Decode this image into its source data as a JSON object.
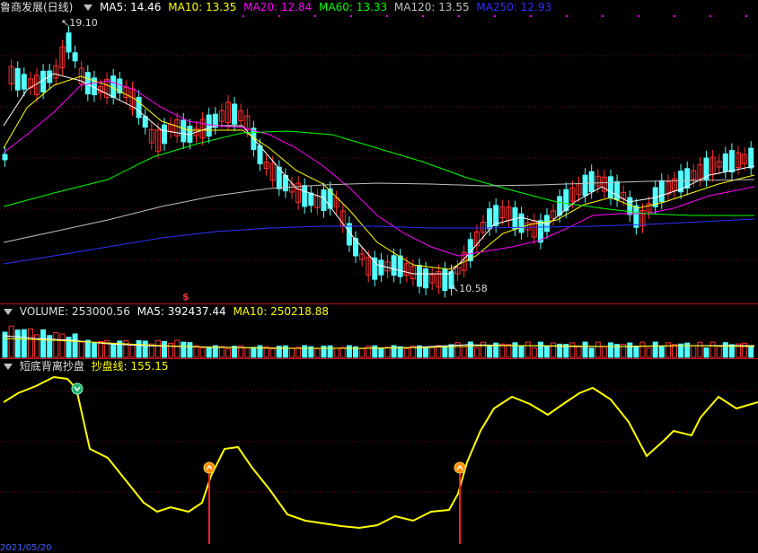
{
  "header": {
    "title": "鲁商发展(日线)",
    "indicators": [
      {
        "label": "MA5: 14.46",
        "color": "#ffffff"
      },
      {
        "label": "MA10: 13.35",
        "color": "#ffff00"
      },
      {
        "label": "MA20: 12.84",
        "color": "#ff00ff"
      },
      {
        "label": "MA60: 13.33",
        "color": "#00ff00"
      },
      {
        "label": "MA120: 13.55",
        "color": "#c0c0c0"
      },
      {
        "label": "MA250: 12.93",
        "color": "#3030ff"
      }
    ]
  },
  "price_chart": {
    "high_label": "19.10",
    "low_label": "10.58",
    "signal_glyph": "$"
  },
  "volume": {
    "title": "VOLUME: 253000.56",
    "ma5": "MA5: 392437.44",
    "ma10": "MA10: 250218.88"
  },
  "oscillator": {
    "title": "短底背离抄盘",
    "line_label": "抄盘线: 155.15"
  },
  "date_footer": "2021/05/20"
}
